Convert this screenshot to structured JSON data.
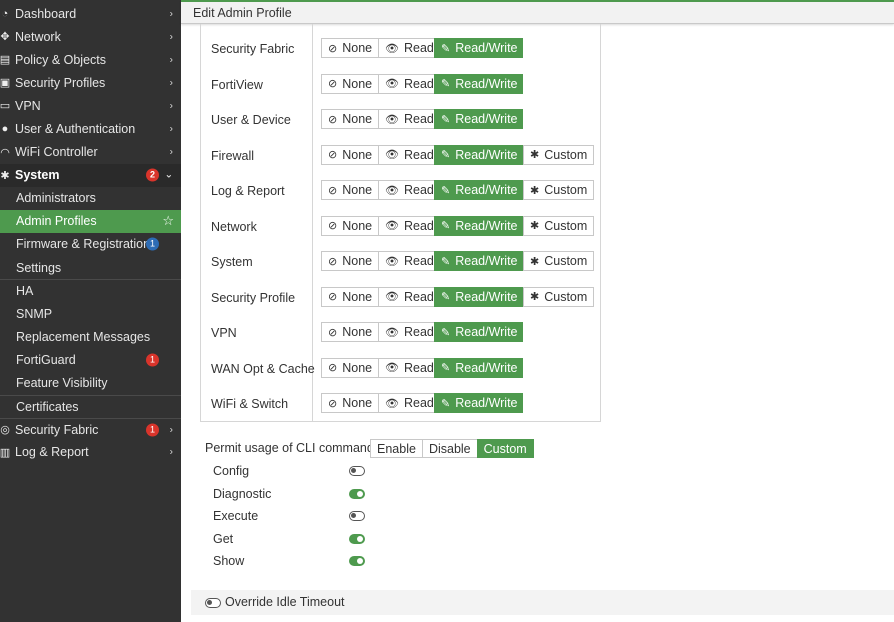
{
  "sidebar": {
    "items": [
      {
        "label": "Dashboard",
        "icon": "dashboard-icon",
        "glyph": "◔",
        "chev": "›"
      },
      {
        "label": "Network",
        "icon": "network-icon",
        "glyph": "✥",
        "chev": "›"
      },
      {
        "label": "Policy & Objects",
        "icon": "policy-icon",
        "glyph": "▤",
        "chev": "›"
      },
      {
        "label": "Security Profiles",
        "icon": "security-profiles-icon",
        "glyph": "▣",
        "chev": "›"
      },
      {
        "label": "VPN",
        "icon": "vpn-icon",
        "glyph": "▭",
        "chev": "›"
      },
      {
        "label": "User & Authentication",
        "icon": "user-icon",
        "glyph": "●",
        "chev": "›"
      },
      {
        "label": "WiFi Controller",
        "icon": "wifi-icon",
        "glyph": "◠",
        "chev": "›"
      },
      {
        "label": "System",
        "icon": "gear-icon",
        "glyph": "✱",
        "badge": "2",
        "chev": "⌄"
      },
      {
        "label": "Administrators"
      },
      {
        "label": "Admin Profiles",
        "star": "☆"
      },
      {
        "label": "Firmware & Registration",
        "badge": "1"
      },
      {
        "label": "Settings"
      },
      {
        "label": "HA"
      },
      {
        "label": "SNMP"
      },
      {
        "label": "Replacement Messages"
      },
      {
        "label": "FortiGuard",
        "badge": "1"
      },
      {
        "label": "Feature Visibility"
      },
      {
        "label": "Certificates"
      },
      {
        "label": "Security Fabric",
        "icon": "security-fabric-icon",
        "glyph": "◎",
        "badge": "1",
        "chev": "›"
      },
      {
        "label": "Log & Report",
        "icon": "chart-icon",
        "glyph": "▥",
        "chev": "›"
      }
    ]
  },
  "header": {
    "title": "Edit Admin Profile"
  },
  "permissions": {
    "options": {
      "none": "None",
      "read": "Read",
      "read_write": "Read/Write",
      "custom": "Custom"
    },
    "icons": {
      "none": "⊘",
      "read": "👁",
      "read_write": "✎",
      "custom": "✱"
    },
    "rows": [
      {
        "label": "Security Fabric",
        "custom": false
      },
      {
        "label": "FortiView",
        "custom": false
      },
      {
        "label": "User & Device",
        "custom": false
      },
      {
        "label": "Firewall",
        "custom": true
      },
      {
        "label": "Log & Report",
        "custom": true
      },
      {
        "label": "Network",
        "custom": true
      },
      {
        "label": "System",
        "custom": true
      },
      {
        "label": "Security Profile",
        "custom": true
      },
      {
        "label": "VPN",
        "custom": false
      },
      {
        "label": "WAN Opt & Cache",
        "custom": false
      },
      {
        "label": "WiFi & Switch",
        "custom": false
      }
    ]
  },
  "cli": {
    "label": "Permit usage of CLI commands",
    "options": [
      "Enable",
      "Disable",
      "Custom"
    ],
    "selected": "Custom",
    "commands": [
      {
        "label": "Config",
        "enabled": false
      },
      {
        "label": "Diagnostic",
        "enabled": true
      },
      {
        "label": "Execute",
        "enabled": false
      },
      {
        "label": "Get",
        "enabled": true
      },
      {
        "label": "Show",
        "enabled": true
      }
    ]
  },
  "idle_timeout": {
    "label": "Override Idle Timeout",
    "enabled": false
  },
  "colors": {
    "accent": "#4e9a4e",
    "sidebar": "#323232",
    "badge_red": "#d9342b",
    "badge_blue": "#2d6cb5"
  }
}
